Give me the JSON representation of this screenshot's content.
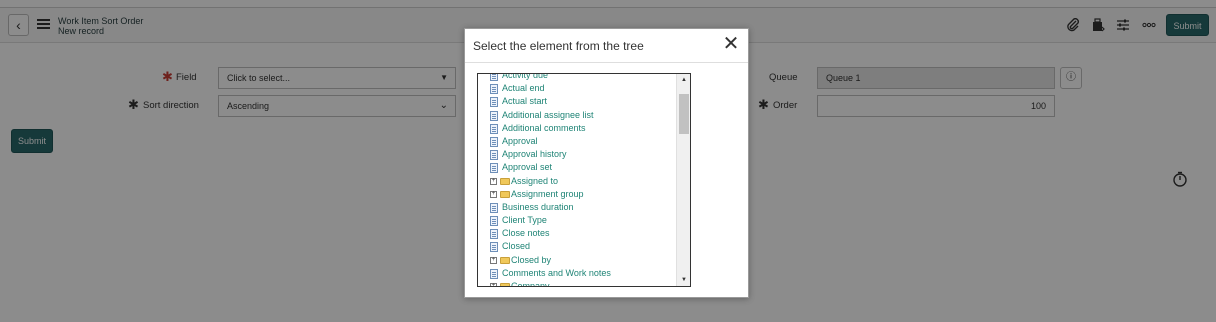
{
  "header": {
    "title": "Work Item Sort Order",
    "subtitle": "New record",
    "submit_label": "Submit",
    "icons": [
      "paperclip-icon",
      "activity-icon",
      "settings-icon",
      "more-icon"
    ]
  },
  "form": {
    "field_label": "Field",
    "field_value": "Click to select...",
    "sort_label": "Sort direction",
    "sort_value": "Ascending",
    "queue_label": "Queue",
    "queue_value": "Queue 1",
    "order_label": "Order",
    "order_value": "100",
    "submit_label": "Submit"
  },
  "modal": {
    "title": "Select the element from the tree",
    "close_glyph": "✕",
    "tree_items": [
      {
        "label": "Activity due",
        "type": "doc"
      },
      {
        "label": "Actual end",
        "type": "doc"
      },
      {
        "label": "Actual start",
        "type": "doc"
      },
      {
        "label": "Additional assignee list",
        "type": "doc"
      },
      {
        "label": "Additional comments",
        "type": "doc"
      },
      {
        "label": "Approval",
        "type": "doc"
      },
      {
        "label": "Approval history",
        "type": "doc"
      },
      {
        "label": "Approval set",
        "type": "doc"
      },
      {
        "label": "Assigned to",
        "type": "folder"
      },
      {
        "label": "Assignment group",
        "type": "folder"
      },
      {
        "label": "Business duration",
        "type": "doc"
      },
      {
        "label": "Client Type",
        "type": "doc"
      },
      {
        "label": "Close notes",
        "type": "doc"
      },
      {
        "label": "Closed",
        "type": "doc"
      },
      {
        "label": "Closed by",
        "type": "folder"
      },
      {
        "label": "Comments and Work notes",
        "type": "doc"
      },
      {
        "label": "Company",
        "type": "folder"
      }
    ]
  },
  "colors": {
    "accent": "#28686b",
    "tree_link": "#1f8476",
    "required": "#c83c36"
  }
}
